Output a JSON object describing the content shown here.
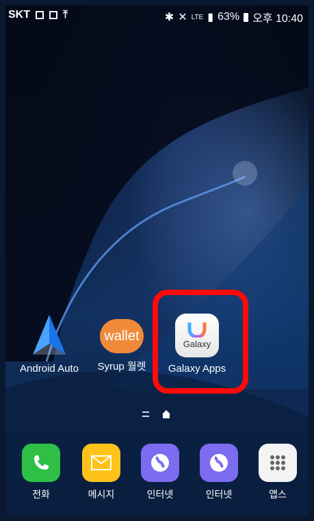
{
  "status_bar": {
    "carrier": "SKT",
    "network": "LTE",
    "battery": "63%",
    "time": "오후 10:40"
  },
  "home_apps": [
    {
      "label": "Android Auto",
      "icon": "android-auto-icon"
    },
    {
      "label": "Syrup 월렛",
      "icon_text": "wallet",
      "icon": "syrup-wallet-icon"
    },
    {
      "label": "Galaxy Apps",
      "icon_text": "Galaxy",
      "icon": "galaxy-apps-icon"
    }
  ],
  "dock": [
    {
      "label": "전화",
      "icon": "phone-icon"
    },
    {
      "label": "메시지",
      "icon": "message-icon"
    },
    {
      "label": "인터넷",
      "icon": "internet-icon"
    },
    {
      "label": "인터넷",
      "icon": "internet-icon"
    },
    {
      "label": "앱스",
      "icon": "apps-grid-icon"
    }
  ],
  "colors": {
    "highlight": "#ff0a0a",
    "phone_green": "#2fbf46",
    "message_yellow": "#ffc21a",
    "internet_purple": "#7b6cf0",
    "wallet_orange": "#f08a3a"
  }
}
